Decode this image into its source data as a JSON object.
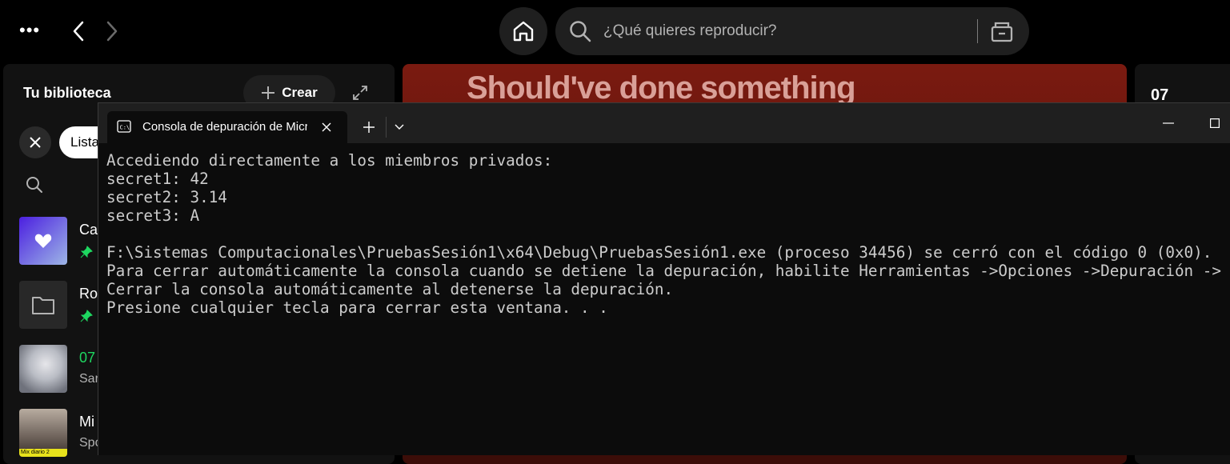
{
  "topbar": {
    "more_icon": "more-horizontal-icon",
    "back_icon": "chevron-left-icon",
    "forward_icon": "chevron-right-icon",
    "home_icon": "home-icon",
    "search_placeholder": "¿Qué quieres reproducir?",
    "browse_icon": "browse-icon"
  },
  "library": {
    "title": "Tu biblioteca",
    "create_label": "Crear",
    "filter_chip": "Lista",
    "items": [
      {
        "name": "Ca",
        "subtitle": "",
        "pinned": true
      },
      {
        "name": "Ro",
        "subtitle": "",
        "pinned": true
      },
      {
        "name": "07",
        "subtitle": "Sar",
        "pinned": false
      },
      {
        "name": "Mi",
        "subtitle": "Spo",
        "pinned": false
      }
    ],
    "mix_label": "Mix diario 2"
  },
  "main": {
    "banner_text": "Should've done something"
  },
  "right_panel": {
    "title": "07"
  },
  "terminal": {
    "tab_title": "Consola de depuración de Microsoft Visual Studio",
    "lines": [
      "Accediendo directamente a los miembros privados:",
      "secret1: 42",
      "secret2: 3.14",
      "secret3: A",
      "",
      "F:\\Sistemas Computacionales\\PruebasSesión1\\x64\\Debug\\PruebasSesión1.exe (proceso 34456) se cerró con el código 0 (0x0).",
      "Para cerrar automáticamente la consola cuando se detiene la depuración, habilite Herramientas ->Opciones ->Depuración ->",
      "Cerrar la consola automáticamente al detenerse la depuración.",
      "Presione cualquier tecla para cerrar esta ventana. . ."
    ]
  },
  "colors": {
    "spotify_green": "#1ed760",
    "terminal_bg": "#0c0c0c",
    "terminal_text": "#cccccc",
    "banner_red": "#7a1a10"
  }
}
